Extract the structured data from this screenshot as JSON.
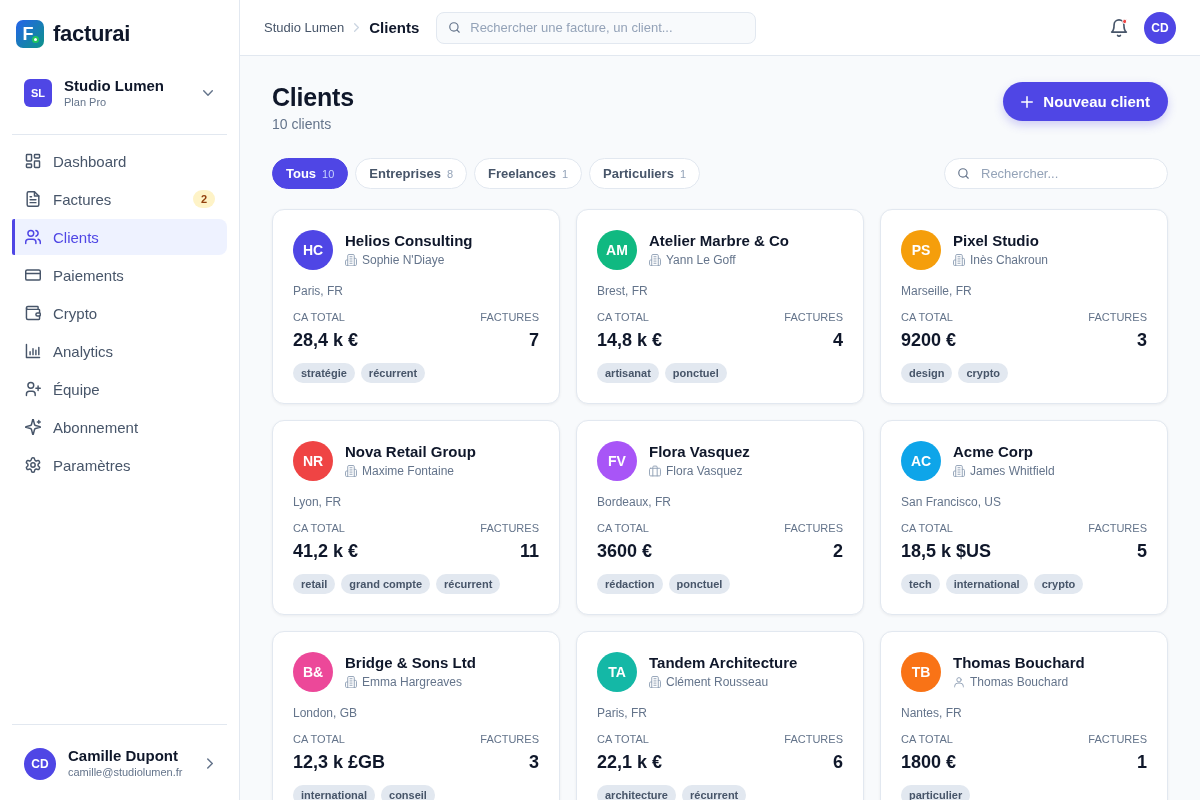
{
  "brand": {
    "logo_letter": "F",
    "name": "facturai"
  },
  "workspace": {
    "initials": "SL",
    "name": "Studio Lumen",
    "plan": "Plan Pro"
  },
  "sidebar": {
    "items": [
      {
        "label": "Dashboard",
        "selected": false
      },
      {
        "label": "Factures",
        "selected": false,
        "badge": "2"
      },
      {
        "label": "Clients",
        "selected": true
      },
      {
        "label": "Paiements",
        "selected": false
      },
      {
        "label": "Crypto",
        "selected": false
      },
      {
        "label": "Analytics",
        "selected": false
      },
      {
        "label": "Équipe",
        "selected": false
      },
      {
        "label": "Abonnement",
        "selected": false
      },
      {
        "label": "Paramètres",
        "selected": false
      }
    ]
  },
  "user": {
    "initials": "CD",
    "name": "Camille Dupont",
    "email": "camille@studiolumen.fr"
  },
  "topbar": {
    "breadcrumb": [
      "Studio Lumen",
      "Clients"
    ],
    "search": {
      "placeholder": "Rechercher une facture, un client..."
    },
    "notifications": {
      "unread": true
    },
    "avatar": "CD"
  },
  "page": {
    "title": "Clients",
    "subtitle": "10 clients",
    "new_button": "Nouveau client"
  },
  "filters": [
    {
      "label": "Tous",
      "count": "10",
      "selected": true
    },
    {
      "label": "Entreprises",
      "count": "8",
      "selected": false
    },
    {
      "label": "Freelances",
      "count": "1",
      "selected": false
    },
    {
      "label": "Particuliers",
      "count": "1",
      "selected": false
    }
  ],
  "client_search": {
    "placeholder": "Rechercher..."
  },
  "clients": [
    {
      "initials": "HC",
      "color": "#4f46e5",
      "name": "Helios Consulting",
      "kind": "company",
      "contact": "Sophie N'Diaye",
      "location": "Paris, FR",
      "revenue_label": "CA TOTAL",
      "revenue": "28,4 k €",
      "invoices_label": "FACTURES",
      "invoices": "7",
      "tags": [
        "stratégie",
        "récurrent"
      ]
    },
    {
      "initials": "AM",
      "color": "#10b981",
      "name": "Atelier Marbre & Co",
      "kind": "company",
      "contact": "Yann Le Goff",
      "location": "Brest, FR",
      "revenue_label": "CA TOTAL",
      "revenue": "14,8 k €",
      "invoices_label": "FACTURES",
      "invoices": "4",
      "tags": [
        "artisanat",
        "ponctuel"
      ]
    },
    {
      "initials": "PS",
      "color": "#f59e0b",
      "name": "Pixel Studio",
      "kind": "company",
      "contact": "Inès Chakroun",
      "location": "Marseille, FR",
      "revenue_label": "CA TOTAL",
      "revenue": "9200 €",
      "invoices_label": "FACTURES",
      "invoices": "3",
      "tags": [
        "design",
        "crypto"
      ]
    },
    {
      "initials": "NR",
      "color": "#ef4444",
      "name": "Nova Retail Group",
      "kind": "company",
      "contact": "Maxime Fontaine",
      "location": "Lyon, FR",
      "revenue_label": "CA TOTAL",
      "revenue": "41,2 k €",
      "invoices_label": "FACTURES",
      "invoices": "11",
      "tags": [
        "retail",
        "grand compte",
        "récurrent"
      ]
    },
    {
      "initials": "FV",
      "color": "#a855f7",
      "name": "Flora Vasquez",
      "kind": "freelance",
      "contact": "Flora Vasquez",
      "location": "Bordeaux, FR",
      "revenue_label": "CA TOTAL",
      "revenue": "3600 €",
      "invoices_label": "FACTURES",
      "invoices": "2",
      "tags": [
        "rédaction",
        "ponctuel"
      ]
    },
    {
      "initials": "AC",
      "color": "#0ea5e9",
      "name": "Acme Corp",
      "kind": "company",
      "contact": "James Whitfield",
      "location": "San Francisco, US",
      "revenue_label": "CA TOTAL",
      "revenue": "18,5 k $US",
      "invoices_label": "FACTURES",
      "invoices": "5",
      "tags": [
        "tech",
        "international",
        "crypto"
      ]
    },
    {
      "initials": "B&",
      "color": "#ec4899",
      "name": "Bridge & Sons Ltd",
      "kind": "company",
      "contact": "Emma Hargreaves",
      "location": "London, GB",
      "revenue_label": "CA TOTAL",
      "revenue": "12,3 k £GB",
      "invoices_label": "FACTURES",
      "invoices": "3",
      "tags": [
        "international",
        "conseil"
      ]
    },
    {
      "initials": "TA",
      "color": "#14b8a6",
      "name": "Tandem Architecture",
      "kind": "company",
      "contact": "Clément Rousseau",
      "location": "Paris, FR",
      "revenue_label": "CA TOTAL",
      "revenue": "22,1 k €",
      "invoices_label": "FACTURES",
      "invoices": "6",
      "tags": [
        "architecture",
        "récurrent"
      ]
    },
    {
      "initials": "TB",
      "color": "#f97316",
      "name": "Thomas Bouchard",
      "kind": "individual",
      "contact": "Thomas Bouchard",
      "location": "Nantes, FR",
      "revenue_label": "CA TOTAL",
      "revenue": "1800 €",
      "invoices_label": "FACTURES",
      "invoices": "1",
      "tags": [
        "particulier"
      ]
    }
  ]
}
